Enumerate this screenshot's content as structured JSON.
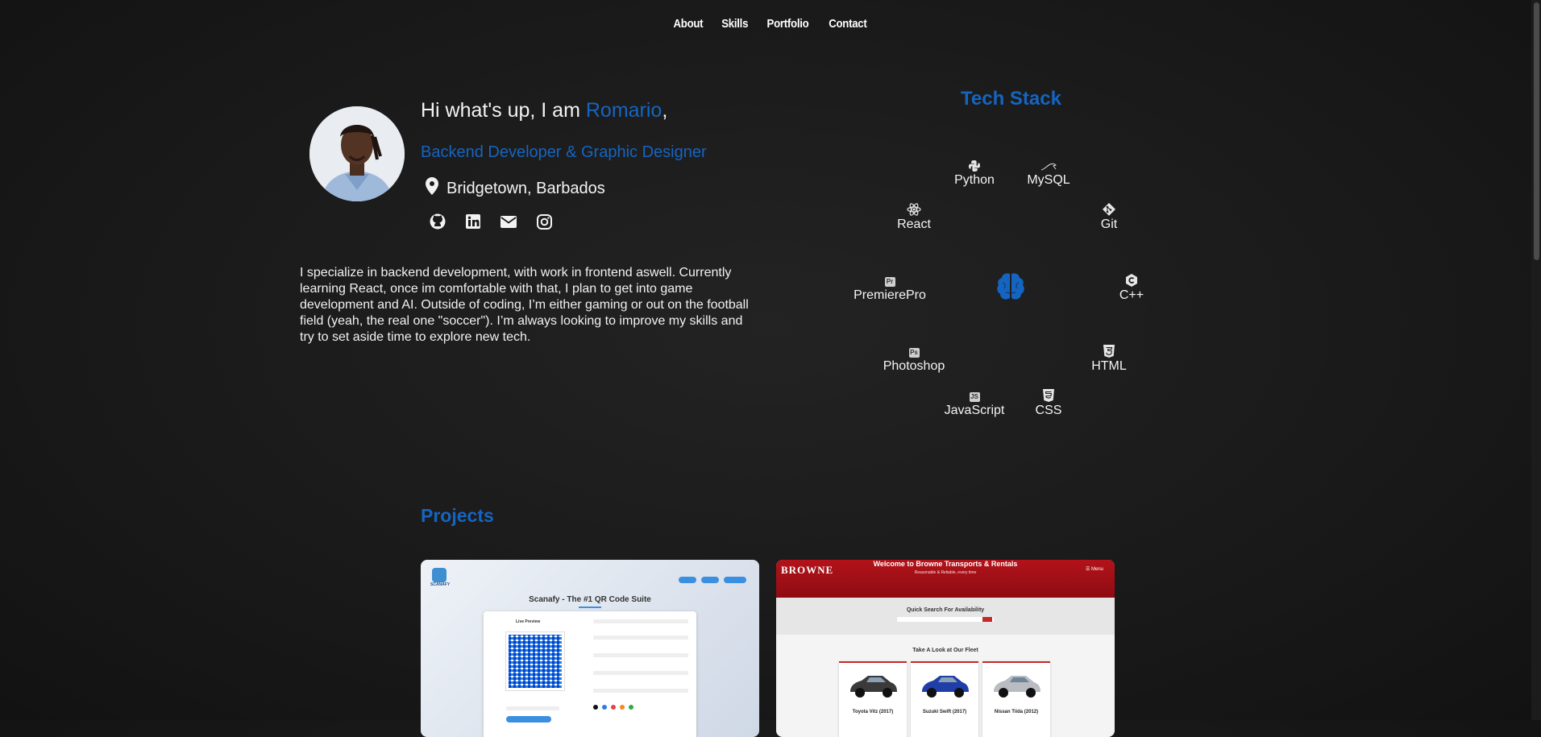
{
  "nav": [
    "About",
    "Skills",
    "Portfolio",
    "Contact"
  ],
  "intro": {
    "greeting_prefix": "Hi what's up, I am ",
    "name": "Romario",
    "greeting_suffix": ",",
    "role": "Backend Developer & Graphic Designer",
    "location": "Bridgetown, Barbados",
    "socials": [
      "github-icon",
      "linkedin-icon",
      "email-icon",
      "instagram-icon"
    ],
    "bio": "I specialize in backend development, with work in frontend aswell. Currently learning React, once im comfortable with that, I plan to get into game development and AI. Outside of coding, I’m either gaming or out on the football field (yeah, the real one \"soccer\"). I’m always looking to improve my skills and try to set aside time to explore new tech."
  },
  "tech_stack": {
    "title": "Tech Stack",
    "items": [
      {
        "label": "Python",
        "icon": "python-icon"
      },
      {
        "label": "MySQL",
        "icon": "mysql-icon"
      },
      {
        "label": "React",
        "icon": "react-icon"
      },
      {
        "label": "Git",
        "icon": "git-icon"
      },
      {
        "label": "PremierePro",
        "icon": "premierepro-icon",
        "badge": "Pr"
      },
      {
        "label": "C++",
        "icon": "cplusplus-icon"
      },
      {
        "label": "Photoshop",
        "icon": "photoshop-icon",
        "badge": "Ps"
      },
      {
        "label": "HTML",
        "icon": "html-icon"
      },
      {
        "label": "JavaScript",
        "icon": "javascript-icon",
        "badge": "JS"
      },
      {
        "label": "CSS",
        "icon": "css-icon"
      }
    ]
  },
  "projects": {
    "title": "Projects",
    "scanafy": {
      "logo": "SCANAFY",
      "heading": "Scanafy - The #1 QR Code Suite",
      "panel_label": "Live Preview"
    },
    "browne": {
      "brand": "BROWNE",
      "title": "Welcome to Browne Transports & Rentals",
      "subtitle": "Reasonable & Reliable, every time",
      "menu": "☰ Menu",
      "quick_search": "Quick Search For Availability",
      "fleet_title": "Take A Look at Our Fleet",
      "cars": [
        "Toyota Vitz (2017)",
        "Suzuki Swift (2017)",
        "Nissan Tiida (2012)"
      ]
    }
  },
  "colors": {
    "accent": "#1565c0",
    "background": "#1b1b1b",
    "text": "#f2f2f2"
  }
}
